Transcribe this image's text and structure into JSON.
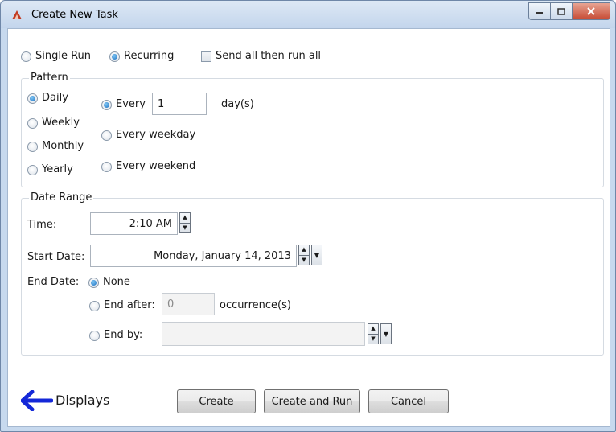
{
  "window": {
    "title": "Create New Task"
  },
  "run_mode": {
    "single_run": "Single Run",
    "recurring": "Recurring",
    "send_all": "Send all then run all"
  },
  "pattern": {
    "legend": "Pattern",
    "types": [
      "Daily",
      "Weekly",
      "Monthly",
      "Yearly"
    ],
    "every_label": "Every",
    "every_value": "1",
    "days_unit": "day(s)",
    "every_weekday": "Every weekday",
    "every_weekend": "Every weekend"
  },
  "date_range": {
    "legend": "Date Range",
    "time_label": "Time:",
    "time_value": "2:10 AM",
    "start_label": "Start Date:",
    "start_value": "Monday, January 14, 2013",
    "end_label": "End Date:",
    "none_label": "None",
    "end_after_label": "End after:",
    "end_after_value": "0",
    "occurrences_label": "occurrence(s)",
    "end_by_label": "End by:"
  },
  "footer": {
    "back_label": "Displays",
    "create": "Create",
    "create_run": "Create and Run",
    "cancel": "Cancel"
  }
}
